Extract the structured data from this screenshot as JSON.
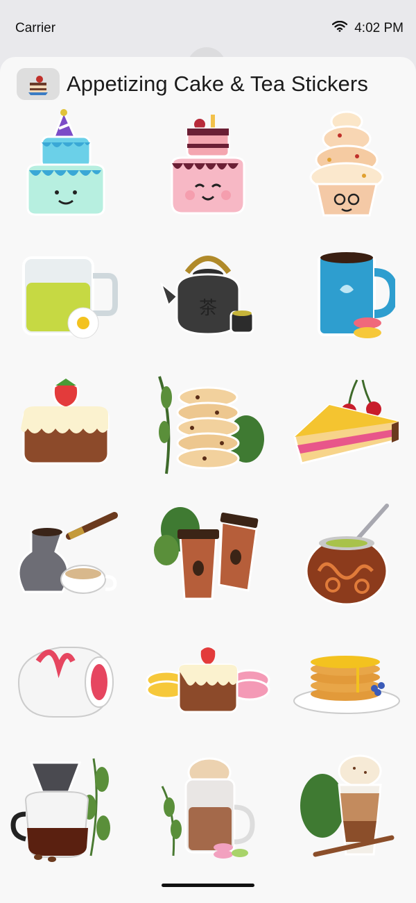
{
  "status_bar": {
    "carrier": "Carrier",
    "time": "4:02 PM",
    "wifi_icon": "wifi-icon"
  },
  "header": {
    "title": "Appetizing Cake & Tea Stickers",
    "app_icon": "cake-app-icon"
  },
  "stickers": [
    {
      "name": "party-hat-cake-sticker"
    },
    {
      "name": "pink-cherry-cake-sticker"
    },
    {
      "name": "tiered-cupcake-sticker"
    },
    {
      "name": "green-tea-glass-sticker"
    },
    {
      "name": "black-teapot-sticker"
    },
    {
      "name": "blue-mug-macarons-sticker"
    },
    {
      "name": "strawberry-cake-sticker"
    },
    {
      "name": "cookie-stack-sticker"
    },
    {
      "name": "cherry-cake-slice-sticker"
    },
    {
      "name": "turkish-coffee-sticker"
    },
    {
      "name": "coffee-cups-to-go-sticker"
    },
    {
      "name": "mate-gourd-sticker"
    },
    {
      "name": "swiss-roll-sticker"
    },
    {
      "name": "cake-and-macarons-sticker"
    },
    {
      "name": "pancake-stack-sticker"
    },
    {
      "name": "coffee-pour-over-sticker"
    },
    {
      "name": "latte-glass-sticker"
    },
    {
      "name": "iced-coffee-sticker"
    }
  ]
}
